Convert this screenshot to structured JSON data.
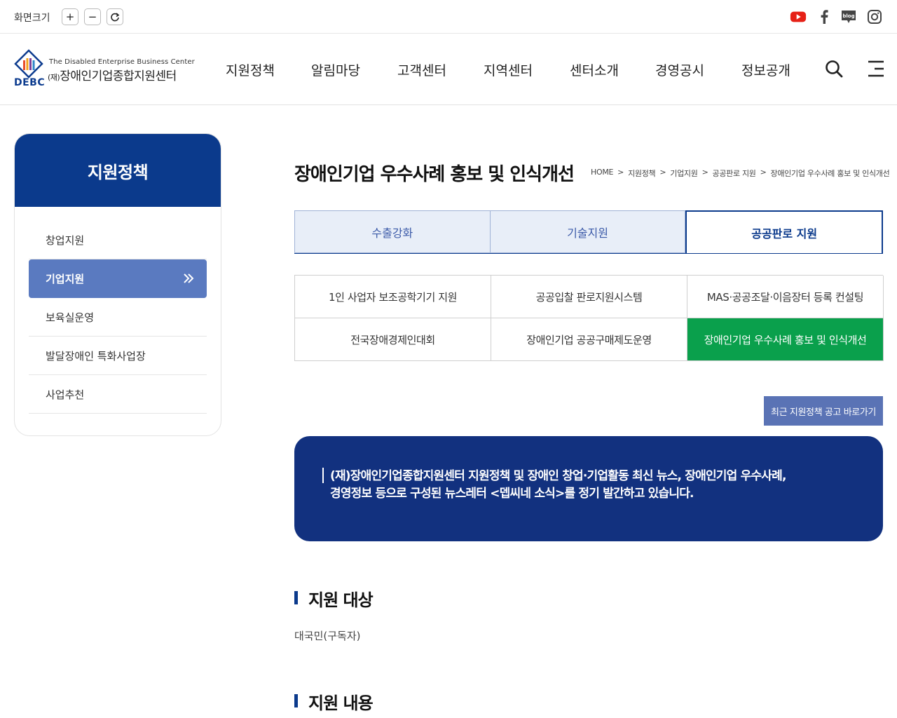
{
  "util": {
    "zoom_label": "화면크기",
    "zoom_in": "+",
    "zoom_out": "−",
    "zoom_reset": "↻"
  },
  "social": {
    "youtube_color": "#e62117",
    "blog_label": "blog"
  },
  "logo": {
    "en": "The Disabled Enterprise Business Center",
    "ko_prefix": "(재)",
    "ko": "장애인기업종합지원센터",
    "abbr": "DEBC"
  },
  "gnb": [
    "지원정책",
    "알림마당",
    "고객센터",
    "지역센터",
    "센터소개",
    "경영공시",
    "정보공개"
  ],
  "sidebar": {
    "title": "지원정책",
    "items": [
      {
        "label": "창업지원"
      },
      {
        "label": "기업지원"
      },
      {
        "label": "보육실운영"
      },
      {
        "label": "발달장애인 특화사업장"
      },
      {
        "label": "사업추천"
      }
    ]
  },
  "page": {
    "title": "장애인기업 우수사례 홍보 및 인식개선",
    "breadcrumb": [
      "HOME",
      "지원정책",
      "기업지원",
      "공공판로 지원",
      "장애인기업 우수사례 홍보 및 인식개선"
    ],
    "breadcrumb_sep": ">"
  },
  "tabs": [
    "수출강화",
    "기술지원",
    "공공판로 지원"
  ],
  "subtabs": [
    "1인 사업자 보조공학기기 지원",
    "공공입찰 판로지원시스템",
    "MAS·공공조달·이음장터 등록 컨설팅",
    "전국장애경제인대회",
    "장애인기업 공공구매제도운영",
    "장애인기업 우수사례 홍보 및 인식개선"
  ],
  "recent_button": "최근 지원정책 공고 바로가기",
  "banner": {
    "line1": "(재)장애인기업종합지원센터 지원정책 및 장애인 창업·기업활동 최신 뉴스, 장애인기업 우수사례,",
    "line2": "경영정보 등으로 구성된 뉴스레터 <뎁씨네 소식>를 정기 발간하고 있습니다."
  },
  "sections": [
    {
      "title": "지원 대상",
      "body": "대국민(구독자)"
    },
    {
      "title": "지원 내용",
      "body": ""
    }
  ]
}
